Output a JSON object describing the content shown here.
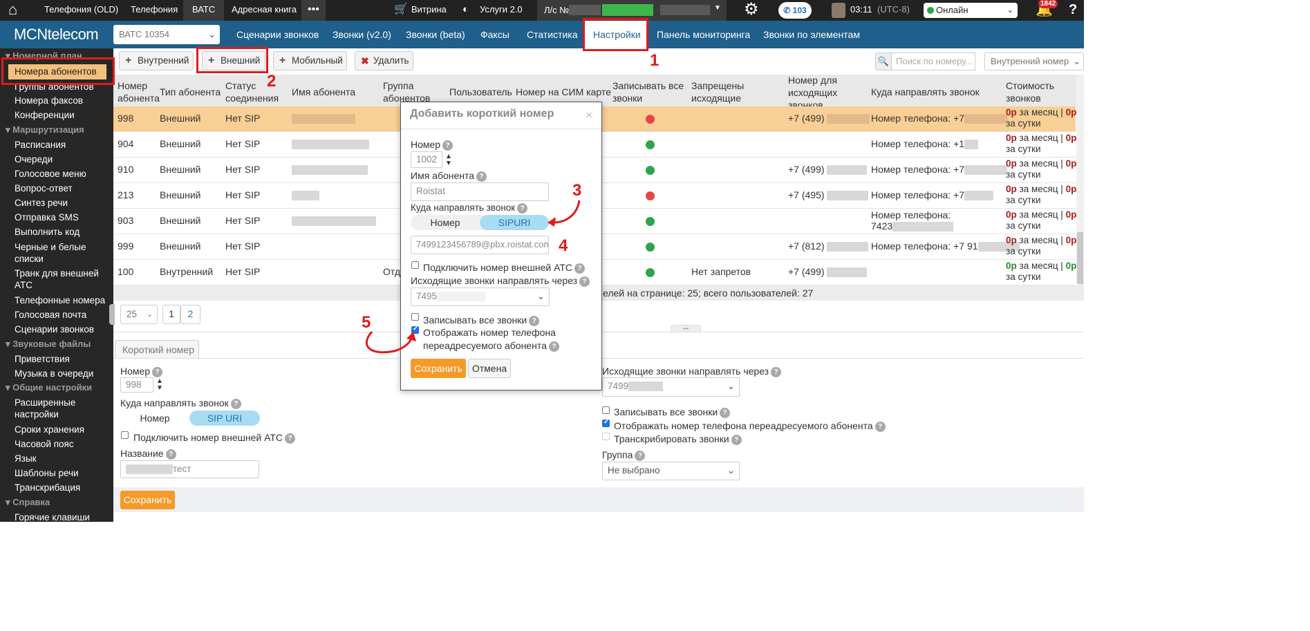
{
  "topbar": {
    "tabs": [
      "Телефония (OLD)",
      "Телефония",
      "ВАТС",
      "Адресная книга"
    ],
    "more": "•••",
    "vitrina": "Витрина",
    "services": "Услуги 2.0",
    "account_prefix": "Л/с №",
    "calls_count": "103",
    "time": "03:11",
    "tz": "(UTC-8)",
    "status": "Онлайн",
    "notifications": "1842",
    "help": "?"
  },
  "navbar": {
    "logo": "MCNtelecom",
    "atc_select": "ВАТС 10354",
    "items": [
      "Сценарии звонков",
      "Звонки (v2.0)",
      "Звонки (beta)",
      "Факсы",
      "Статистика",
      "Настройки",
      "Панель мониторинга",
      "Звонки по элементам"
    ]
  },
  "sidebar": {
    "group_numbering": "Номерной план",
    "items_numbering": [
      "Номера абонентов",
      "Группы абонентов",
      "Номера факсов",
      "Конференции"
    ],
    "group_routing": "Маршрутизация",
    "items_routing": [
      "Расписания",
      "Очереди",
      "Голосовое меню",
      "Вопрос-ответ",
      "Синтез речи",
      "Отправка SMS",
      "Выполнить код",
      "Черные и белые списки",
      "Транк для внешней АТС",
      "Телефонные номера",
      "Голосовая почта",
      "Сценарии звонков"
    ],
    "group_sound": "Звуковые файлы",
    "items_sound": [
      "Приветствия",
      "Музыка в очереди"
    ],
    "group_general": "Общие настройки",
    "items_general": [
      "Расширенные настройки",
      "Сроки хранения",
      "Часовой пояс",
      "Язык",
      "Шаблоны речи",
      "Транскрибация"
    ],
    "group_help": "Справка",
    "items_help": [
      "Горячие клавиши"
    ]
  },
  "toolbar": {
    "internal": "Внутренний",
    "external": "Внешний",
    "mobile": "Мобильный",
    "delete": "Удалить",
    "search_placeholder": "Поиск по номеру...",
    "type_select": "Внутренний номер"
  },
  "table": {
    "headers": [
      "Номер абонента",
      "Тип абонента",
      "Статус соединения",
      "Имя абонента",
      "Группа абонентов",
      "Пользователь",
      "Номер на СИМ карте",
      "Записывать все звонки",
      "Запрещены исходящие звонки",
      "Номер для исходящих звонков",
      "Куда направлять звонок",
      "Стоимость звонков"
    ],
    "rows": [
      {
        "num": "998",
        "type": "Внешний",
        "status": "Нет SIP",
        "record": "red",
        "out_num": "+7 (499)",
        "route": "Номер телефона: +7",
        "group": "",
        "restrict": ""
      },
      {
        "num": "904",
        "type": "Внешний",
        "status": "Нет SIP",
        "record": "green",
        "out_num": "",
        "route": "Номер телефона: +1",
        "group": "",
        "restrict": ""
      },
      {
        "num": "910",
        "type": "Внешний",
        "status": "Нет SIP",
        "record": "green",
        "out_num": "+7 (499)",
        "route": "Номер телефона: +7",
        "group": "",
        "restrict": ""
      },
      {
        "num": "213",
        "type": "Внешний",
        "status": "Нет SIP",
        "record": "red",
        "out_num": "+7 (495)",
        "route": "Номер телефона: +7",
        "group": "",
        "restrict": ""
      },
      {
        "num": "903",
        "type": "Внешний",
        "status": "Нет SIP",
        "record": "green",
        "out_num": "",
        "route": "Номер телефона:",
        "route2": "7423",
        "group": "",
        "restrict": ""
      },
      {
        "num": "999",
        "type": "Внешний",
        "status": "Нет SIP",
        "record": "green",
        "out_num": "+7 (812)",
        "route": "Номер телефона: +7 91",
        "group": "",
        "restrict": ""
      },
      {
        "num": "100",
        "type": "Внутренний",
        "status": "Нет SIP",
        "record": "green",
        "out_num": "+7 (499)",
        "route": "",
        "group": "Отд",
        "restrict": "Нет запретов"
      }
    ],
    "cost_line1_value": "0р",
    "cost_line1_suffix": " за месяц | ",
    "cost_line1_value2": "0р",
    "cost_line2": "за сутки"
  },
  "pager": {
    "summary": "елей на странице: 25; всего пользователей: 27",
    "per_page": "25",
    "pages": [
      "1",
      "2"
    ]
  },
  "detail": {
    "tab": "Короткий номер",
    "number_label": "Номер",
    "number_value": "998",
    "route_label": "Куда направлять звонок",
    "route_opt1": "Номер",
    "route_opt2": "SIP URI",
    "ext_atc": "Подключить номер внешней АТС",
    "name_label": "Название",
    "name_value": "тест",
    "outgoing_label": "Исходящие звонки направлять через",
    "outgoing_value": "7499",
    "record_all": "Записывать все звонки",
    "show_forwarded": "Отображать номер телефона переадресуемого абонента",
    "transcribe": "Транскрибировать звонки",
    "group_label": "Группа",
    "group_value": "Не выбрано",
    "save": "Сохранить"
  },
  "modal": {
    "title": "Добавить короткий номер",
    "close": "×",
    "number_label": "Номер",
    "number_value": "1002",
    "name_label": "Имя абонента",
    "name_value": "Roistat",
    "route_label": "Куда направлять звонок",
    "route_opt1": "Номер",
    "route_opt2": "SIPURI",
    "sip_value": "7499123456789@pbx.roistat.com",
    "ext_atc": "Подключить номер внешней АТС",
    "outgoing_label": "Исходящие звонки направлять через",
    "outgoing_value": "7495",
    "record_all": "Записывать все звонки",
    "show_forwarded": "Отображать номер телефона переадресуемого абонента",
    "save": "Сохранить",
    "cancel": "Отмена"
  },
  "annotations": [
    "1",
    "2",
    "3",
    "4",
    "5"
  ],
  "colors": {
    "accent": "#1f5f8b",
    "highlight_row": "#f8cf94",
    "annotation": "#e01b1b",
    "save": "#f59a2a"
  }
}
